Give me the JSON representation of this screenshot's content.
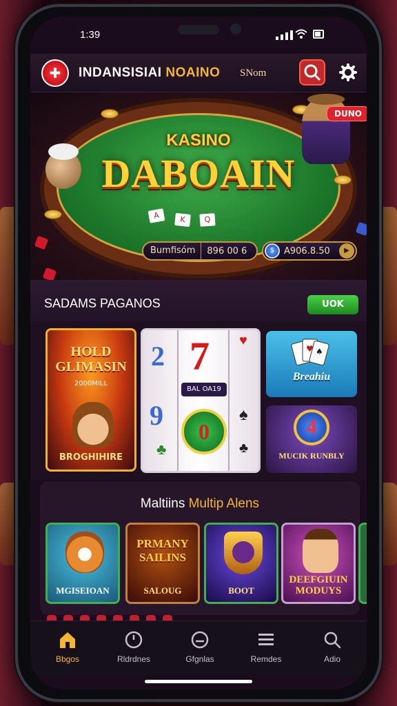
{
  "status_bar": {
    "time": "1:39"
  },
  "app_bar": {
    "brand_part1": "INDANSISIAI",
    "brand_part2": "NOAINO",
    "secondary_text": "SNom",
    "logo_glyph": "✚"
  },
  "hero": {
    "kicker": "KASINO",
    "title": "DABOAIN",
    "badge": "DUNO",
    "pill_left_label": "Bumfisóm",
    "pill_left_value": "896 00 6",
    "pill_right_value": "A906.8.50",
    "cards": [
      "A",
      "K",
      "Q"
    ]
  },
  "section1": {
    "title": "SADAMS PAGANOS",
    "more_label": "UOK",
    "tiles": [
      {
        "title": "HOLD GLIMASIN",
        "subtitle": "2000MILL",
        "caption": "BROGHIHIRE"
      },
      {
        "label": "BAL OA19",
        "chip_value": "0",
        "symbols": [
          "2",
          "7",
          "9"
        ]
      },
      {
        "caption": "Breahiu"
      },
      {
        "emblem": "4",
        "caption": "MUCIK RUNBLY"
      }
    ]
  },
  "section2": {
    "title_part1": "Maltiins",
    "title_part2": "Multip Alens",
    "tiles": [
      {
        "caption": "MGISEIOAN"
      },
      {
        "title": "PRMANY SAILINS",
        "caption": "SALOUG"
      },
      {
        "caption": "BOOT"
      },
      {
        "caption": "DEEFGIUIN MODUYS"
      }
    ]
  },
  "tabbar": {
    "items": [
      {
        "label": "Bbgos",
        "icon": "home-icon",
        "active": true
      },
      {
        "label": "Rldrdnes",
        "icon": "clock-icon",
        "active": false
      },
      {
        "label": "Gfgnlas",
        "icon": "circle-icon",
        "active": false
      },
      {
        "label": "Remdes",
        "icon": "menu-icon",
        "active": false
      },
      {
        "label": "Adio",
        "icon": "search-icon",
        "active": false
      }
    ]
  },
  "colors": {
    "accent_gold": "#f2b630",
    "accent_red": "#c0282a",
    "accent_green": "#2ea83a",
    "background": "#1a0c1c"
  }
}
